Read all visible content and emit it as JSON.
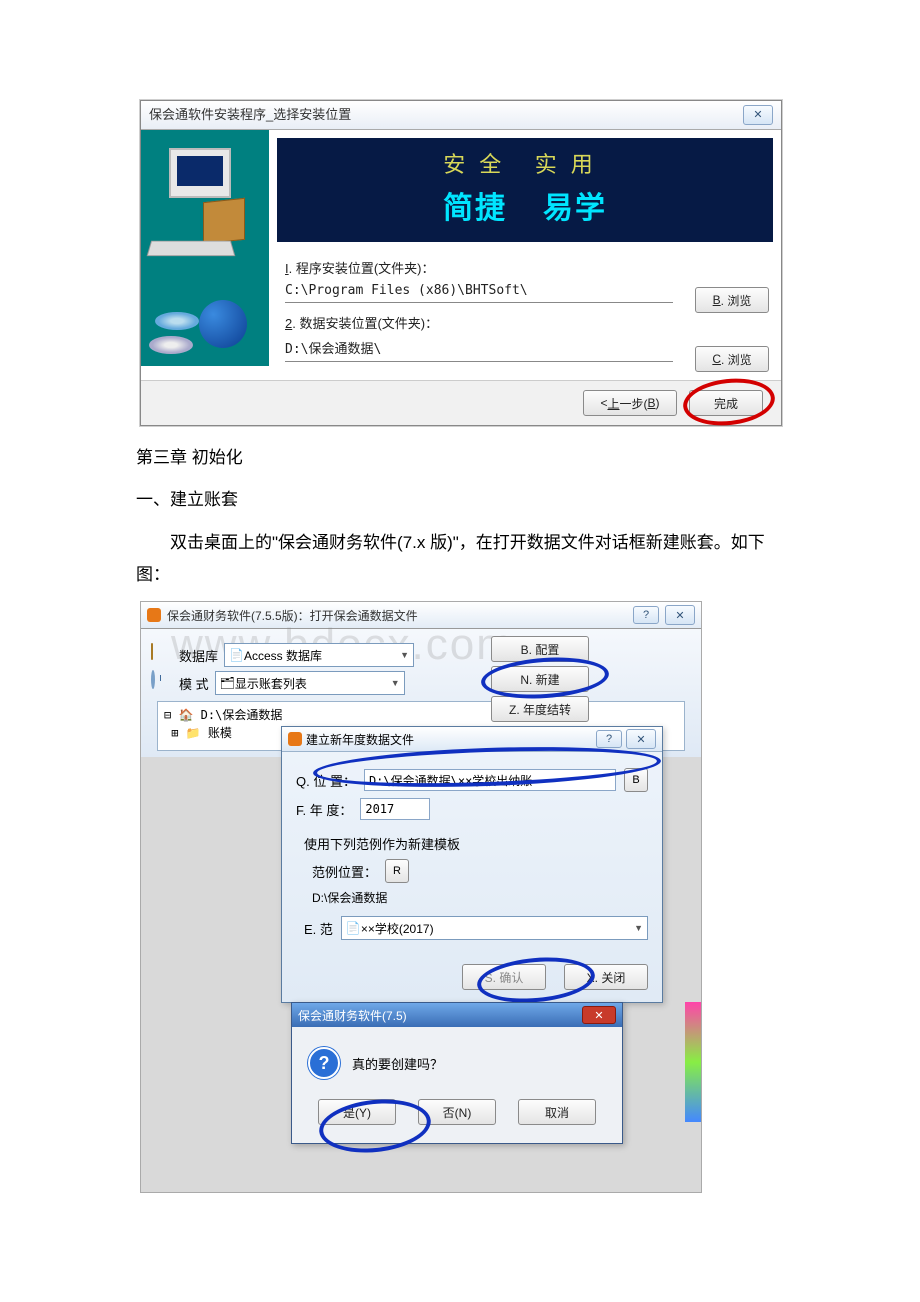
{
  "installer": {
    "title": "保会通软件安装程序_选择安装位置",
    "banner_line1": "安全  实用",
    "banner_line2_a": "简捷",
    "banner_line2_b": "易学",
    "label_program": "I. 程序安装位置(文件夹)：",
    "path_program": "C:\\Program Files (x86)\\BHTSoft\\",
    "label_data": "2. 数据安装位置(文件夹)：",
    "path_data": "D:\\保会通数据\\",
    "btn_browse_b": "B. 浏览",
    "btn_browse_c": "C. 浏览",
    "btn_back": "< 上一步(B)",
    "btn_finish": "完成"
  },
  "text": {
    "chapter": "第三章 初始化",
    "sec1": "一、建立账套",
    "para1": "双击桌面上的\"保会通财务软件(7.x 版)\"，在打开数据文件对话框新建账套。如下图："
  },
  "opendlg": {
    "title": "保会通财务软件(7.5.5版)：打开保会通数据文件",
    "watermark": "www.bdocx.com",
    "db_label": "数据库",
    "db_value": "Access 数据库",
    "mode_label": "模   式",
    "mode_value": "显示账套列表",
    "btn_config": "B. 配置",
    "btn_new": "N. 新建",
    "btn_year": "Z. 年度结转",
    "tree_root": "D:\\保会通数据",
    "tree_child": "账模"
  },
  "newyear": {
    "title": "建立新年度数据文件",
    "loc_label": "Q. 位   置：",
    "loc_value": "D:\\保会通数据\\××学校出纳账",
    "loc_btn": "B",
    "year_label": "F. 年   度：",
    "year_value": "2017",
    "tpl_hint": "使用下列范例作为新建模板",
    "tpl_loc_label": "范例位置：",
    "tpl_loc_btn": "R",
    "tpl_loc_path": "D:\\保会通数据",
    "tpl_label": "E. 范",
    "tpl_value": "××学校(2017)",
    "btn_ok": "S. 确认",
    "btn_close": "X. 关闭"
  },
  "confirm": {
    "title": "保会通财务软件(7.5)",
    "msg": "真的要创建吗？",
    "btn_yes": "是(Y)",
    "btn_no": "否(N)",
    "btn_cancel": "取消"
  }
}
